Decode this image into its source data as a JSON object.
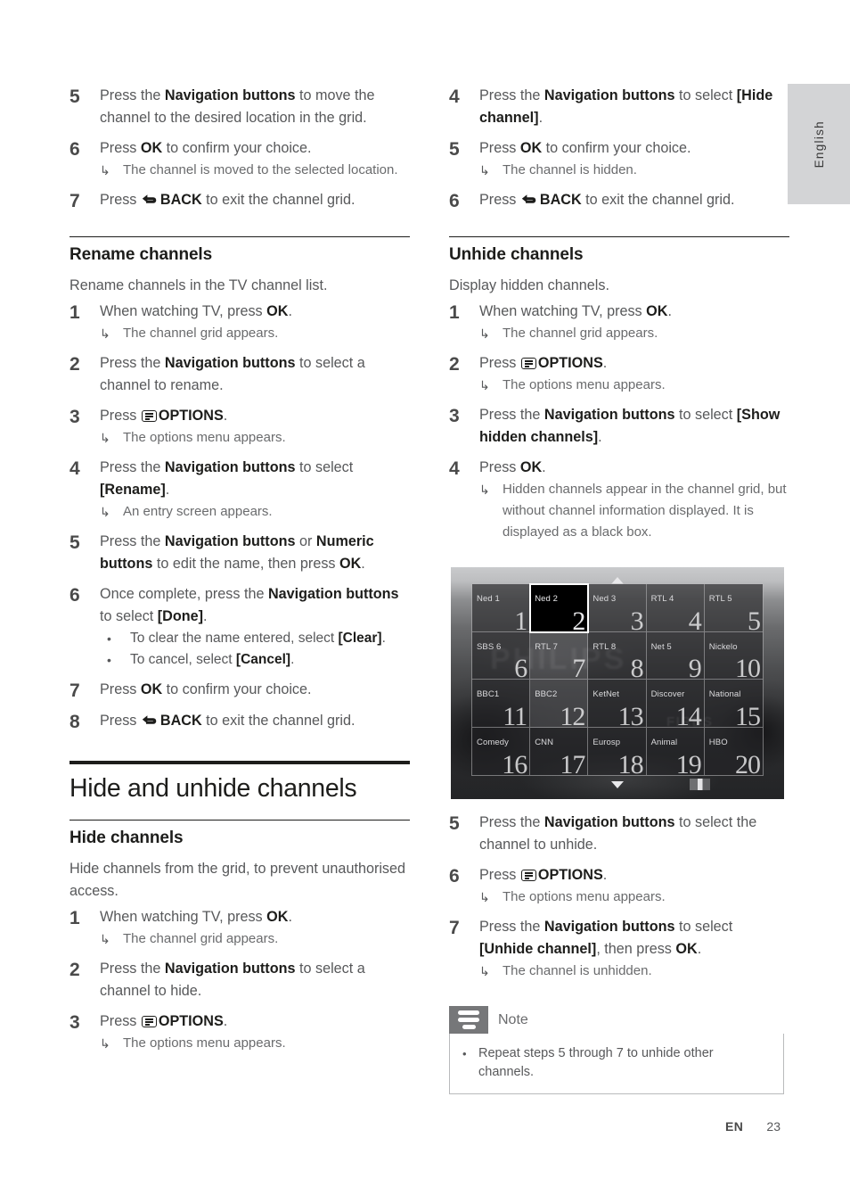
{
  "sidebar": {
    "language_tab": "English"
  },
  "footer": {
    "lang_code": "EN",
    "page_number": "23"
  },
  "icons": {
    "options": "options-icon",
    "back": "back-arrow-icon",
    "result_arrow": "↳",
    "bullet": "•"
  },
  "left_column": {
    "continued_steps": [
      {
        "num": "5",
        "parts": [
          {
            "t": "Press the "
          },
          {
            "t": "Navigation buttons",
            "b": true
          },
          {
            "t": " to move the channel to the desired location in the grid."
          }
        ]
      },
      {
        "num": "6",
        "parts": [
          {
            "t": "Press "
          },
          {
            "t": "OK",
            "b": true
          },
          {
            "t": " to confirm your choice."
          }
        ],
        "results": [
          "The channel is moved to the selected location."
        ]
      },
      {
        "num": "7",
        "icon": "back",
        "parts": [
          {
            "t": "Press "
          },
          {
            "t": "BACK",
            "b": true,
            "icon": "back"
          },
          {
            "t": " to exit the channel grid."
          }
        ]
      }
    ],
    "rename_section": {
      "heading": "Rename channels",
      "intro": "Rename channels in the TV channel list.",
      "steps": [
        {
          "num": "1",
          "parts": [
            {
              "t": "When watching TV, press "
            },
            {
              "t": "OK",
              "b": true
            },
            {
              "t": "."
            }
          ],
          "results": [
            "The channel grid appears."
          ]
        },
        {
          "num": "2",
          "parts": [
            {
              "t": "Press the "
            },
            {
              "t": "Navigation buttons",
              "b": true
            },
            {
              "t": " to select a channel to rename."
            }
          ]
        },
        {
          "num": "3",
          "parts": [
            {
              "t": "Press "
            },
            {
              "t": "OPTIONS",
              "b": true,
              "icon": "options"
            },
            {
              "t": "."
            }
          ],
          "results": [
            "The options menu appears."
          ]
        },
        {
          "num": "4",
          "parts": [
            {
              "t": "Press the "
            },
            {
              "t": "Navigation buttons",
              "b": true
            },
            {
              "t": " to select "
            },
            {
              "t": "[Rename]",
              "b": true
            },
            {
              "t": "."
            }
          ],
          "results": [
            "An entry screen appears."
          ]
        },
        {
          "num": "5",
          "parts": [
            {
              "t": "Press the "
            },
            {
              "t": "Navigation buttons",
              "b": true
            },
            {
              "t": " or "
            },
            {
              "t": "Numeric buttons",
              "b": true
            },
            {
              "t": " to edit the name, then press "
            },
            {
              "t": "OK",
              "b": true
            },
            {
              "t": "."
            }
          ]
        },
        {
          "num": "6",
          "parts": [
            {
              "t": "Once complete, press the "
            },
            {
              "t": "Navigation buttons",
              "b": true
            },
            {
              "t": " to select "
            },
            {
              "t": "[Done]",
              "b": true
            },
            {
              "t": "."
            }
          ],
          "bullets": [
            [
              {
                "t": "To clear the name entered, select "
              },
              {
                "t": "[Clear]",
                "b": true
              },
              {
                "t": "."
              }
            ],
            [
              {
                "t": "To cancel, select "
              },
              {
                "t": "[Cancel]",
                "b": true
              },
              {
                "t": "."
              }
            ]
          ]
        },
        {
          "num": "7",
          "parts": [
            {
              "t": "Press "
            },
            {
              "t": "OK",
              "b": true
            },
            {
              "t": " to confirm your choice."
            }
          ]
        },
        {
          "num": "8",
          "parts": [
            {
              "t": "Press "
            },
            {
              "t": "BACK",
              "b": true,
              "icon": "back"
            },
            {
              "t": " to exit the channel grid."
            }
          ]
        }
      ]
    },
    "chapter": {
      "title": "Hide and unhide channels"
    },
    "hide_section": {
      "heading": "Hide channels",
      "intro": "Hide channels from the grid, to prevent unauthorised access.",
      "steps": [
        {
          "num": "1",
          "parts": [
            {
              "t": "When watching TV, press "
            },
            {
              "t": "OK",
              "b": true
            },
            {
              "t": "."
            }
          ],
          "results": [
            "The channel grid appears."
          ]
        },
        {
          "num": "2",
          "parts": [
            {
              "t": "Press the "
            },
            {
              "t": "Navigation buttons",
              "b": true
            },
            {
              "t": " to select a channel to hide."
            }
          ]
        },
        {
          "num": "3",
          "parts": [
            {
              "t": "Press "
            },
            {
              "t": "OPTIONS",
              "b": true,
              "icon": "options"
            },
            {
              "t": "."
            }
          ],
          "results": [
            "The options menu appears."
          ]
        }
      ]
    }
  },
  "right_column": {
    "continued_steps": [
      {
        "num": "4",
        "parts": [
          {
            "t": "Press the "
          },
          {
            "t": "Navigation buttons",
            "b": true
          },
          {
            "t": " to select "
          },
          {
            "t": "[Hide channel]",
            "b": true
          },
          {
            "t": "."
          }
        ]
      },
      {
        "num": "5",
        "parts": [
          {
            "t": "Press "
          },
          {
            "t": "OK",
            "b": true
          },
          {
            "t": " to confirm your choice."
          }
        ],
        "results": [
          "The channel is hidden."
        ]
      },
      {
        "num": "6",
        "parts": [
          {
            "t": "Press "
          },
          {
            "t": "BACK",
            "b": true,
            "icon": "back"
          },
          {
            "t": " to exit the channel grid."
          }
        ]
      }
    ],
    "unhide_section": {
      "heading": "Unhide channels",
      "intro": "Display hidden channels.",
      "steps_before_figure": [
        {
          "num": "1",
          "parts": [
            {
              "t": "When watching TV, press "
            },
            {
              "t": "OK",
              "b": true
            },
            {
              "t": "."
            }
          ],
          "results": [
            "The channel grid appears."
          ]
        },
        {
          "num": "2",
          "parts": [
            {
              "t": "Press "
            },
            {
              "t": "OPTIONS",
              "b": true,
              "icon": "options"
            },
            {
              "t": "."
            }
          ],
          "results": [
            "The options menu appears."
          ]
        },
        {
          "num": "3",
          "parts": [
            {
              "t": "Press the "
            },
            {
              "t": "Navigation buttons",
              "b": true
            },
            {
              "t": " to select "
            },
            {
              "t": "[Show hidden channels]",
              "b": true
            },
            {
              "t": "."
            }
          ]
        },
        {
          "num": "4",
          "parts": [
            {
              "t": "Press "
            },
            {
              "t": "OK",
              "b": true
            },
            {
              "t": "."
            }
          ],
          "results": [
            "Hidden channels appear in the channel grid, but without channel information displayed. It is displayed as a black box."
          ]
        }
      ],
      "steps_after_figure": [
        {
          "num": "5",
          "parts": [
            {
              "t": "Press the "
            },
            {
              "t": "Navigation buttons",
              "b": true
            },
            {
              "t": " to select the channel to unhide."
            }
          ]
        },
        {
          "num": "6",
          "parts": [
            {
              "t": "Press "
            },
            {
              "t": "OPTIONS",
              "b": true,
              "icon": "options"
            },
            {
              "t": "."
            }
          ],
          "results": [
            "The options menu appears."
          ]
        },
        {
          "num": "7",
          "parts": [
            {
              "t": "Press the "
            },
            {
              "t": "Navigation buttons",
              "b": true
            },
            {
              "t": " to select "
            },
            {
              "t": "[Unhide channel]",
              "b": true
            },
            {
              "t": ", then press "
            },
            {
              "t": "OK",
              "b": true
            },
            {
              "t": "."
            }
          ],
          "results": [
            "The channel is unhidden."
          ]
        }
      ]
    },
    "note": {
      "title": "Note",
      "items": [
        "Repeat steps 5 through 7 to unhide other channels."
      ]
    }
  },
  "figure": {
    "name": "tv-channel-grid-screenshot",
    "background_text": "PHILIPS",
    "background_text_2": "FIRBS",
    "hidden_channel_index": 1,
    "cells": [
      {
        "name": "Ned 1",
        "num": "1",
        "shade": "dim-1"
      },
      {
        "name": "Ned 2",
        "num": "2",
        "shade": "hidden-box"
      },
      {
        "name": "Ned 3",
        "num": "3",
        "shade": "dim-1"
      },
      {
        "name": "RTL 4",
        "num": "4",
        "shade": "dim-1"
      },
      {
        "name": "RTL 5",
        "num": "5",
        "shade": "dim-1"
      },
      {
        "name": "SBS 6",
        "num": "6",
        "shade": "dim-2"
      },
      {
        "name": "RTL 7",
        "num": "7",
        "shade": "dim-3"
      },
      {
        "name": "RTL 8",
        "num": "8",
        "shade": "dim-2"
      },
      {
        "name": "Net 5",
        "num": "9",
        "shade": "dim-2"
      },
      {
        "name": "Nickelo",
        "num": "10",
        "shade": "dim-2"
      },
      {
        "name": "BBC1",
        "num": "11",
        "shade": "dim-2"
      },
      {
        "name": "BBC2",
        "num": "12",
        "shade": "dim-3"
      },
      {
        "name": "KetNet",
        "num": "13",
        "shade": "dim-2"
      },
      {
        "name": "Discover",
        "num": "14",
        "shade": "dim-2"
      },
      {
        "name": "National",
        "num": "15",
        "shade": "dim-2"
      },
      {
        "name": "Comedy",
        "num": "16",
        "shade": "dim-2"
      },
      {
        "name": "CNN",
        "num": "17",
        "shade": "dim-2"
      },
      {
        "name": "Eurosp",
        "num": "18",
        "shade": "dim-2"
      },
      {
        "name": "Animal",
        "num": "19",
        "shade": "dim-2"
      },
      {
        "name": "HBO",
        "num": "20",
        "shade": "dim-2"
      }
    ]
  }
}
